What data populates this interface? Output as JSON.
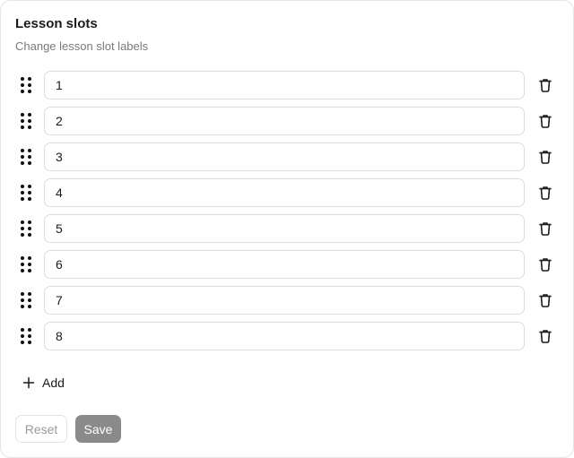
{
  "header": {
    "title": "Lesson slots",
    "subtitle": "Change lesson slot labels"
  },
  "slots": [
    {
      "value": "1"
    },
    {
      "value": "2"
    },
    {
      "value": "3"
    },
    {
      "value": "4"
    },
    {
      "value": "5"
    },
    {
      "value": "6"
    },
    {
      "value": "7"
    },
    {
      "value": "8"
    }
  ],
  "actions": {
    "add_label": "Add",
    "reset_label": "Reset",
    "save_label": "Save"
  },
  "icons": {
    "drag": "drag-handle-icon",
    "delete": "trash-icon",
    "add": "plus-icon"
  },
  "colors": {
    "save_button_bg": "#8a8a8a",
    "border": "#dcdcdc"
  }
}
